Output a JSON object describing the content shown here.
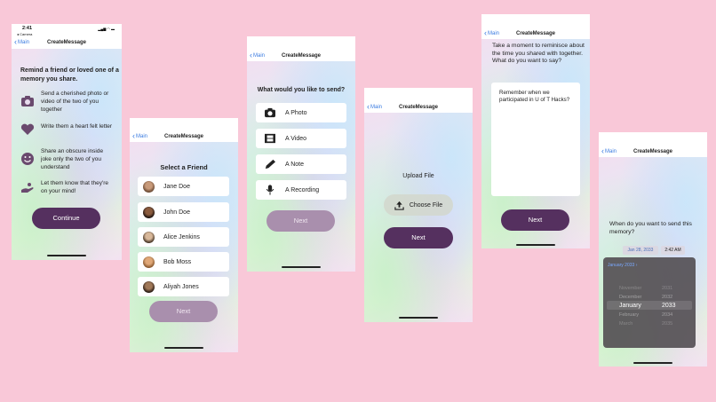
{
  "colors": {
    "background": "#f9c8d8",
    "accent_dark": "#55305f",
    "link_blue": "#3a7be0"
  },
  "screen1": {
    "status_time": "2:41",
    "status_camera": "◂ Camera",
    "nav_back": "Main",
    "nav_title": "CreateMessage",
    "heading": "Remind a friend or loved one of a memory you share.",
    "options": [
      {
        "icon": "camera-icon",
        "text": "Send a cherished photo or video of the two of you together"
      },
      {
        "icon": "heart-icon",
        "text": "Write them a heart felt letter"
      },
      {
        "icon": "smiley-icon",
        "text": "Share an obscure inside joke only the two of you understand"
      },
      {
        "icon": "hand-icon",
        "text": "Let them know that they're on your mind!"
      }
    ],
    "continue": "Continue"
  },
  "screen2": {
    "nav_back": "Main",
    "nav_title": "CreateMessage",
    "heading": "Select a Friend",
    "friends": [
      "Jane Doe",
      "John Doe",
      "Alice Jenkins",
      "Bob Moss",
      "Aliyah Jones"
    ],
    "next": "Next"
  },
  "screen3": {
    "nav_back": "Main",
    "nav_title": "CreateMessage",
    "heading": "What would you like to send?",
    "options": [
      {
        "icon": "camera-icon",
        "label": "A Photo"
      },
      {
        "icon": "film-icon",
        "label": "A Video"
      },
      {
        "icon": "pencil-icon",
        "label": "A Note"
      },
      {
        "icon": "microphone-icon",
        "label": "A Recording"
      }
    ],
    "next": "Next"
  },
  "screen4": {
    "nav_back": "Main",
    "nav_title": "CreateMessage",
    "heading": "Upload File",
    "choose_file": "Choose File",
    "next": "Next"
  },
  "screen5": {
    "nav_back": "Main",
    "nav_title": "CreateMessage",
    "prompt": "Take a moment to reminisce about the time you shared with together. What do you want to say?",
    "textarea_value": "Remember when we participated in U of T Hacks?",
    "next": "Next"
  },
  "screen6": {
    "nav_back": "Main",
    "nav_title": "CreateMessage",
    "question": "When do you want to send this memory?",
    "date_value": "Jan 28, 2033",
    "time_value": "2:42 AM",
    "picker_header": "January 2033 ›",
    "months": [
      "November",
      "December",
      "January",
      "February",
      "March"
    ],
    "years": [
      "2031",
      "2032",
      "2033",
      "2034",
      "2035"
    ]
  }
}
